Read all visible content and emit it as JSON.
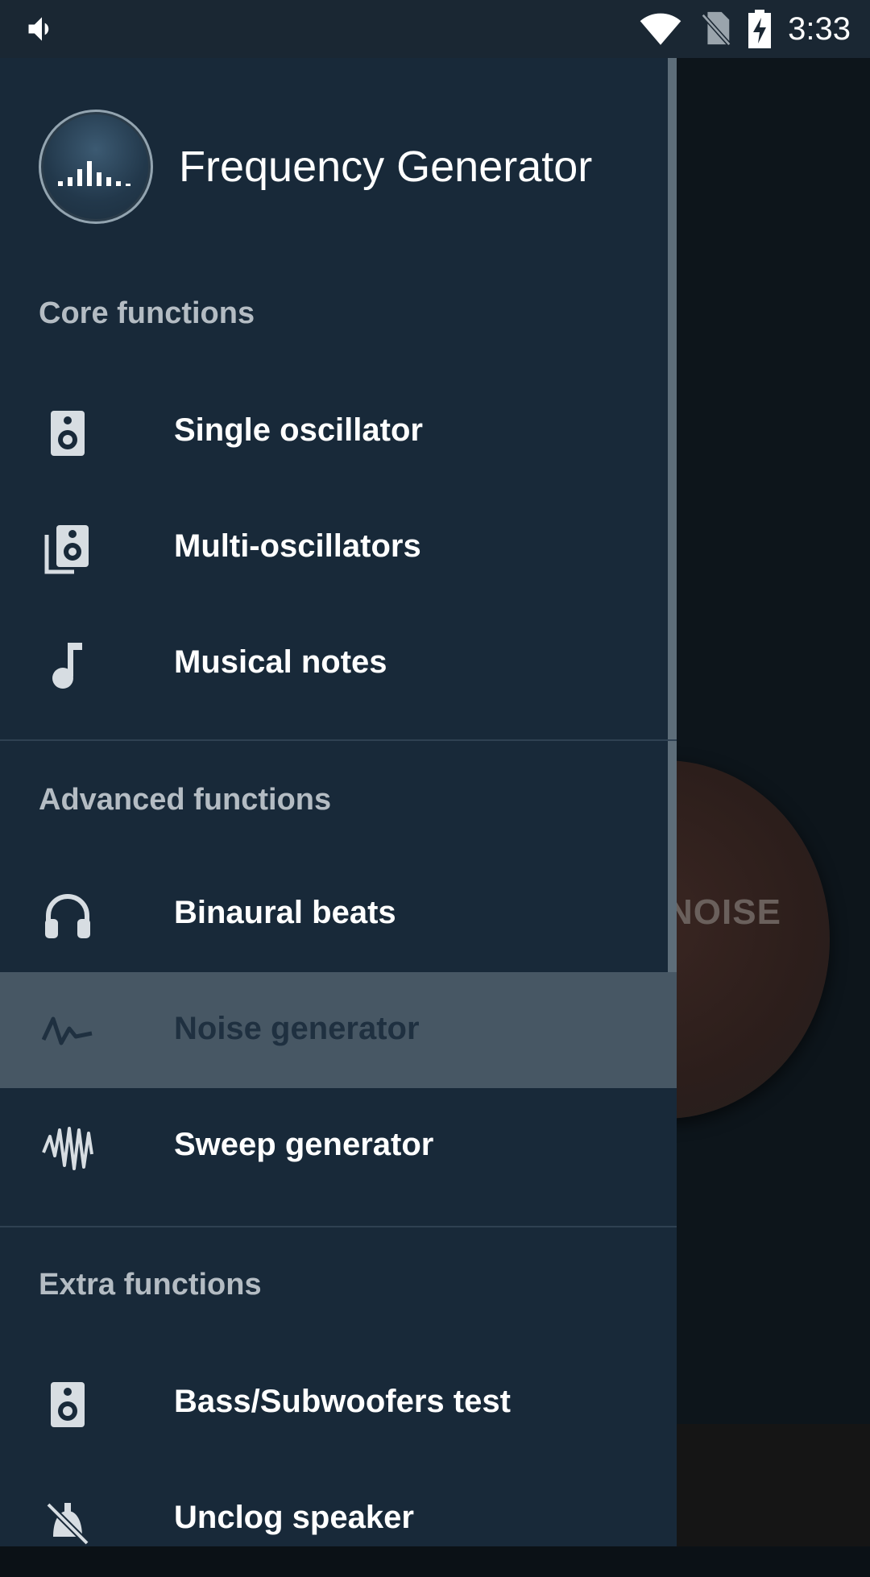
{
  "status_bar": {
    "time": "3:33",
    "icons": [
      "volume-icon",
      "wifi-icon",
      "no-sim-icon",
      "battery-charging-icon"
    ]
  },
  "background": {
    "noise_button_label": "NOISE"
  },
  "drawer": {
    "app_title": "Frequency Generator",
    "sections": [
      {
        "title": "Core functions",
        "items": [
          {
            "label": "Single oscillator",
            "icon": "speaker-icon"
          },
          {
            "label": "Multi-oscillators",
            "icon": "multi-speaker-icon"
          },
          {
            "label": "Musical notes",
            "icon": "music-note-icon"
          }
        ]
      },
      {
        "title": "Advanced functions",
        "items": [
          {
            "label": "Binaural beats",
            "icon": "headphones-icon"
          },
          {
            "label": "Noise generator",
            "icon": "noise-wave-icon",
            "selected": true
          },
          {
            "label": "Sweep generator",
            "icon": "sweep-wave-icon"
          }
        ]
      },
      {
        "title": "Extra functions",
        "items": [
          {
            "label": "Bass/Subwoofers test",
            "icon": "speaker-icon"
          },
          {
            "label": "Unclog speaker",
            "icon": "unclog-speaker-icon"
          }
        ]
      }
    ]
  },
  "colors": {
    "drawer_bg": "#182939",
    "selected_bg": "#475764",
    "status_bar_bg": "#1a2733",
    "section_text": "#b4bcc3"
  }
}
